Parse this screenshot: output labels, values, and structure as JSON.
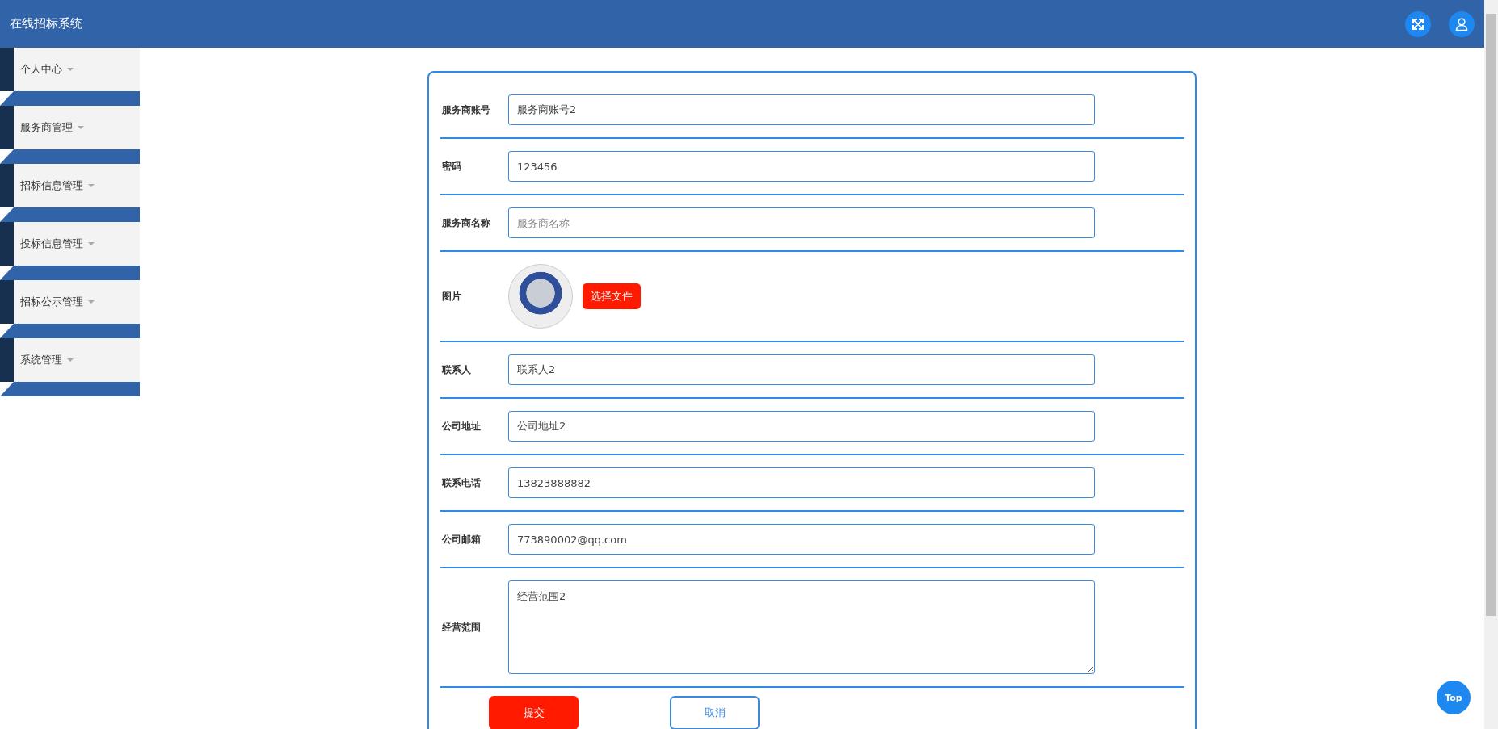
{
  "header": {
    "title": "在线招标系统"
  },
  "sidebar": {
    "items": [
      {
        "label": "个人中心"
      },
      {
        "label": "服务商管理"
      },
      {
        "label": "招标信息管理"
      },
      {
        "label": "投标信息管理"
      },
      {
        "label": "招标公示管理"
      },
      {
        "label": "系统管理"
      }
    ]
  },
  "form": {
    "fields": [
      {
        "kind": "text",
        "label": "服务商账号",
        "value": "服务商账号2"
      },
      {
        "kind": "text",
        "label": "密码",
        "value": "123456"
      },
      {
        "kind": "text",
        "label": "服务商名称",
        "placeholder": "服务商名称"
      },
      {
        "kind": "image",
        "label": "图片",
        "button": "选择文件"
      },
      {
        "kind": "text",
        "label": "联系人",
        "value": "联系人2"
      },
      {
        "kind": "text",
        "label": "公司地址",
        "value": "公司地址2"
      },
      {
        "kind": "text",
        "label": "联系电话",
        "value": "13823888882"
      },
      {
        "kind": "text",
        "label": "公司邮箱",
        "value": "773890002@qq.com"
      },
      {
        "kind": "textarea",
        "label": "经营范围",
        "value": "经营范围2"
      }
    ],
    "buttons": [
      {
        "kind": "primary",
        "label": "提交"
      },
      {
        "kind": "outline",
        "label": "取消"
      }
    ]
  },
  "back_to_top": "Top"
}
